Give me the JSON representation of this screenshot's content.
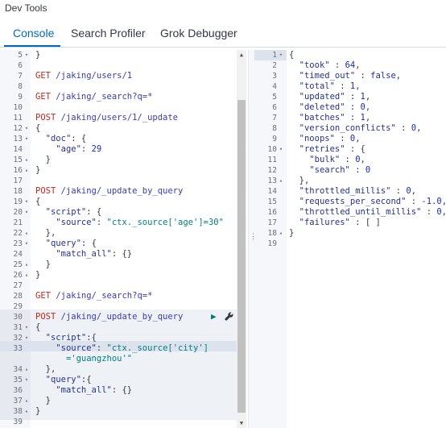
{
  "app": {
    "title": "Dev Tools"
  },
  "tabs": [
    {
      "label": "Console",
      "active": true
    },
    {
      "label": "Search Profiler",
      "active": false
    },
    {
      "label": "Grok Debugger",
      "active": false
    }
  ],
  "icons": {
    "fold_open": "▾",
    "fold_closed": "▸",
    "play": "▶",
    "wrench": "🔧",
    "scroll_up": "▲",
    "scroll_down": "▼",
    "splitter": "⋮"
  },
  "colors": {
    "accent": "#006bb8",
    "method": "#c5281c",
    "string": "#008080",
    "play": "#017d73"
  },
  "request_editor": {
    "lines": [
      {
        "n": "5",
        "fold": "▾",
        "tokens": [
          [
            "punct",
            "}"
          ]
        ]
      },
      {
        "n": "6",
        "fold": "",
        "tokens": []
      },
      {
        "n": "7",
        "fold": "",
        "tokens": [
          [
            "kw-method",
            "GET "
          ],
          [
            "kw-url",
            "/jaking/users/1"
          ]
        ]
      },
      {
        "n": "8",
        "fold": "",
        "tokens": []
      },
      {
        "n": "9",
        "fold": "",
        "tokens": [
          [
            "kw-method",
            "GET "
          ],
          [
            "kw-url",
            "/jaking/_search?q=*"
          ]
        ]
      },
      {
        "n": "10",
        "fold": "",
        "tokens": []
      },
      {
        "n": "11",
        "fold": "",
        "tokens": [
          [
            "kw-method",
            "POST "
          ],
          [
            "kw-url",
            "/jaking/users/1/_update"
          ]
        ]
      },
      {
        "n": "12",
        "fold": "▾",
        "tokens": [
          [
            "punct",
            "{"
          ]
        ]
      },
      {
        "n": "13",
        "fold": "▾",
        "tokens": [
          [
            "punct",
            "  "
          ],
          [
            "kw-key",
            "\"doc\""
          ],
          [
            "punct",
            ": {"
          ]
        ]
      },
      {
        "n": "14",
        "fold": "",
        "tokens": [
          [
            "punct",
            "    "
          ],
          [
            "kw-key",
            "\"age\""
          ],
          [
            "punct",
            ": "
          ],
          [
            "kw-num",
            "29"
          ]
        ]
      },
      {
        "n": "15",
        "fold": "▴",
        "tokens": [
          [
            "punct",
            "  }"
          ]
        ]
      },
      {
        "n": "16",
        "fold": "▴",
        "tokens": [
          [
            "punct",
            "}"
          ]
        ]
      },
      {
        "n": "17",
        "fold": "",
        "tokens": []
      },
      {
        "n": "18",
        "fold": "",
        "tokens": [
          [
            "kw-method",
            "POST "
          ],
          [
            "kw-url",
            "/jaking/_update_by_query"
          ]
        ]
      },
      {
        "n": "19",
        "fold": "▾",
        "tokens": [
          [
            "punct",
            "{"
          ]
        ]
      },
      {
        "n": "20",
        "fold": "▾",
        "tokens": [
          [
            "punct",
            "  "
          ],
          [
            "kw-key",
            "\"script\""
          ],
          [
            "punct",
            ": {"
          ]
        ]
      },
      {
        "n": "21",
        "fold": "",
        "tokens": [
          [
            "punct",
            "    "
          ],
          [
            "kw-key",
            "\"source\""
          ],
          [
            "punct",
            ": "
          ],
          [
            "kw-str",
            "\"ctx._source['age']=30\""
          ]
        ]
      },
      {
        "n": "22",
        "fold": "▴",
        "tokens": [
          [
            "punct",
            "  },"
          ]
        ]
      },
      {
        "n": "23",
        "fold": "▾",
        "tokens": [
          [
            "punct",
            "  "
          ],
          [
            "kw-key",
            "\"query\""
          ],
          [
            "punct",
            ": {"
          ]
        ]
      },
      {
        "n": "24",
        "fold": "",
        "tokens": [
          [
            "punct",
            "    "
          ],
          [
            "kw-key",
            "\"match_all\""
          ],
          [
            "punct",
            ": {}"
          ]
        ]
      },
      {
        "n": "25",
        "fold": "▴",
        "tokens": [
          [
            "punct",
            "  }"
          ]
        ]
      },
      {
        "n": "26",
        "fold": "▴",
        "tokens": [
          [
            "punct",
            "}"
          ]
        ]
      },
      {
        "n": "27",
        "fold": "",
        "tokens": []
      },
      {
        "n": "28",
        "fold": "",
        "tokens": [
          [
            "kw-method",
            "GET "
          ],
          [
            "kw-url",
            "/jaking/_search?q=*"
          ]
        ]
      },
      {
        "n": "29",
        "fold": "",
        "tokens": []
      },
      {
        "n": "30",
        "fold": "",
        "tokens": [
          [
            "kw-method",
            "POST "
          ],
          [
            "kw-url",
            "/jaking/_update_by_query"
          ]
        ]
      },
      {
        "n": "31",
        "fold": "▾",
        "tokens": [
          [
            "punct",
            "{"
          ]
        ]
      },
      {
        "n": "32",
        "fold": "▾",
        "tokens": [
          [
            "punct",
            "  "
          ],
          [
            "kw-key",
            "\"script\""
          ],
          [
            "punct",
            ":{"
          ]
        ]
      },
      {
        "n": "33",
        "fold": "",
        "tokens": [
          [
            "punct",
            "    "
          ],
          [
            "kw-key",
            "\"source\""
          ],
          [
            "punct",
            ": "
          ],
          [
            "kw-str",
            "\"ctx._source['city']"
          ]
        ]
      },
      {
        "n": "",
        "fold": "",
        "tokens": [
          [
            "punct",
            "      "
          ],
          [
            "kw-str",
            "='guangzhou'\""
          ]
        ]
      },
      {
        "n": "34",
        "fold": "▴",
        "tokens": [
          [
            "punct",
            "  },"
          ]
        ]
      },
      {
        "n": "35",
        "fold": "▾",
        "tokens": [
          [
            "punct",
            "  "
          ],
          [
            "kw-key",
            "\"query\""
          ],
          [
            "punct",
            ":{"
          ]
        ]
      },
      {
        "n": "36",
        "fold": "",
        "tokens": [
          [
            "punct",
            "    "
          ],
          [
            "kw-key",
            "\"match_all\""
          ],
          [
            "punct",
            ": {}"
          ]
        ]
      },
      {
        "n": "37",
        "fold": "▴",
        "tokens": [
          [
            "punct",
            "  }"
          ]
        ]
      },
      {
        "n": "38",
        "fold": "▴",
        "tokens": [
          [
            "punct",
            "}"
          ]
        ]
      },
      {
        "n": "39",
        "fold": "",
        "tokens": []
      }
    ]
  },
  "response_viewer": {
    "lines": [
      {
        "n": "1",
        "fold": "▾",
        "tokens": [
          [
            "punct",
            "{"
          ]
        ]
      },
      {
        "n": "2",
        "fold": "",
        "tokens": [
          [
            "punct",
            "  "
          ],
          [
            "kw-key",
            "\"took\""
          ],
          [
            "punct",
            " : "
          ],
          [
            "kw-num",
            "64"
          ],
          [
            "punct",
            ","
          ]
        ]
      },
      {
        "n": "3",
        "fold": "",
        "tokens": [
          [
            "punct",
            "  "
          ],
          [
            "kw-key",
            "\"timed_out\""
          ],
          [
            "punct",
            " : "
          ],
          [
            "kw-bool",
            "false"
          ],
          [
            "punct",
            ","
          ]
        ]
      },
      {
        "n": "4",
        "fold": "",
        "tokens": [
          [
            "punct",
            "  "
          ],
          [
            "kw-key",
            "\"total\""
          ],
          [
            "punct",
            " : "
          ],
          [
            "kw-num",
            "1"
          ],
          [
            "punct",
            ","
          ]
        ]
      },
      {
        "n": "5",
        "fold": "",
        "tokens": [
          [
            "punct",
            "  "
          ],
          [
            "kw-key",
            "\"updated\""
          ],
          [
            "punct",
            " : "
          ],
          [
            "kw-num",
            "1"
          ],
          [
            "punct",
            ","
          ]
        ]
      },
      {
        "n": "6",
        "fold": "",
        "tokens": [
          [
            "punct",
            "  "
          ],
          [
            "kw-key",
            "\"deleted\""
          ],
          [
            "punct",
            " : "
          ],
          [
            "kw-num",
            "0"
          ],
          [
            "punct",
            ","
          ]
        ]
      },
      {
        "n": "7",
        "fold": "",
        "tokens": [
          [
            "punct",
            "  "
          ],
          [
            "kw-key",
            "\"batches\""
          ],
          [
            "punct",
            " : "
          ],
          [
            "kw-num",
            "1"
          ],
          [
            "punct",
            ","
          ]
        ]
      },
      {
        "n": "8",
        "fold": "",
        "tokens": [
          [
            "punct",
            "  "
          ],
          [
            "kw-key",
            "\"version_conflicts\""
          ],
          [
            "punct",
            " : "
          ],
          [
            "kw-num",
            "0"
          ],
          [
            "punct",
            ","
          ]
        ]
      },
      {
        "n": "9",
        "fold": "",
        "tokens": [
          [
            "punct",
            "  "
          ],
          [
            "kw-key",
            "\"noops\""
          ],
          [
            "punct",
            " : "
          ],
          [
            "kw-num",
            "0"
          ],
          [
            "punct",
            ","
          ]
        ]
      },
      {
        "n": "10",
        "fold": "▾",
        "tokens": [
          [
            "punct",
            "  "
          ],
          [
            "kw-key",
            "\"retries\""
          ],
          [
            "punct",
            " : {"
          ]
        ]
      },
      {
        "n": "11",
        "fold": "",
        "tokens": [
          [
            "punct",
            "    "
          ],
          [
            "kw-key",
            "\"bulk\""
          ],
          [
            "punct",
            " : "
          ],
          [
            "kw-num",
            "0"
          ],
          [
            "punct",
            ","
          ]
        ]
      },
      {
        "n": "12",
        "fold": "",
        "tokens": [
          [
            "punct",
            "    "
          ],
          [
            "kw-key",
            "\"search\""
          ],
          [
            "punct",
            " : "
          ],
          [
            "kw-num",
            "0"
          ]
        ]
      },
      {
        "n": "13",
        "fold": "▴",
        "tokens": [
          [
            "punct",
            "  },"
          ]
        ]
      },
      {
        "n": "14",
        "fold": "",
        "tokens": [
          [
            "punct",
            "  "
          ],
          [
            "kw-key",
            "\"throttled_millis\""
          ],
          [
            "punct",
            " : "
          ],
          [
            "kw-num",
            "0"
          ],
          [
            "punct",
            ","
          ]
        ]
      },
      {
        "n": "15",
        "fold": "",
        "tokens": [
          [
            "punct",
            "  "
          ],
          [
            "kw-key",
            "\"requests_per_second\""
          ],
          [
            "punct",
            " : "
          ],
          [
            "kw-num",
            "-1.0"
          ],
          [
            "punct",
            ","
          ]
        ]
      },
      {
        "n": "16",
        "fold": "",
        "tokens": [
          [
            "punct",
            "  "
          ],
          [
            "kw-key",
            "\"throttled_until_millis\""
          ],
          [
            "punct",
            " : "
          ],
          [
            "kw-num",
            "0"
          ],
          [
            "punct",
            ","
          ]
        ]
      },
      {
        "n": "17",
        "fold": "",
        "tokens": [
          [
            "punct",
            "  "
          ],
          [
            "kw-key",
            "\"failures\""
          ],
          [
            "punct",
            " : [ ]"
          ]
        ]
      },
      {
        "n": "18",
        "fold": "▴",
        "tokens": [
          [
            "punct",
            "}"
          ]
        ]
      },
      {
        "n": "19",
        "fold": "",
        "tokens": []
      }
    ]
  }
}
